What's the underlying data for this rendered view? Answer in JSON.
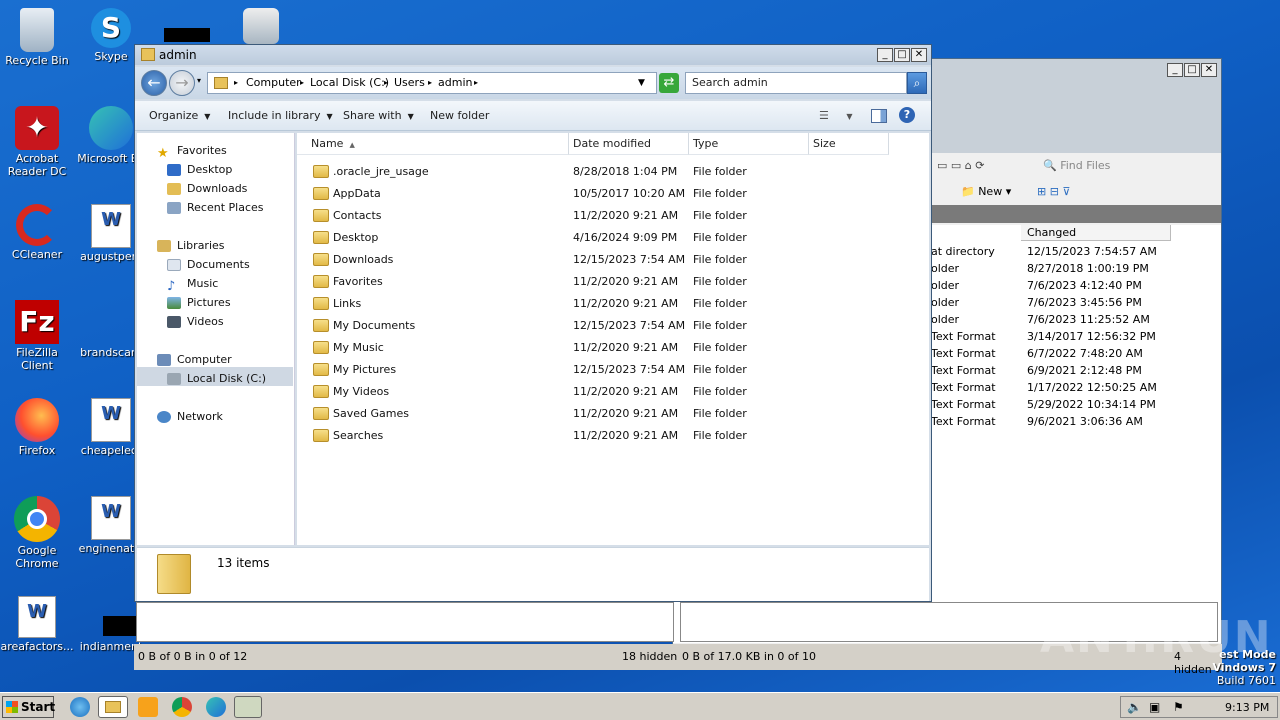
{
  "desktop": {
    "icons": [
      {
        "label": "Recycle Bin",
        "icon": "recycle-bin-icon"
      },
      {
        "label": "Skype",
        "icon": "skype-icon"
      },
      {
        "label": "Acrobat Reader DC",
        "icon": "acrobat-icon"
      },
      {
        "label": "Microsoft Ed",
        "icon": "edge-icon"
      },
      {
        "label": "CCleaner",
        "icon": "ccleaner-icon"
      },
      {
        "label": "augustpers",
        "icon": "word-doc-icon"
      },
      {
        "label": "FileZilla Client",
        "icon": "filezilla-icon"
      },
      {
        "label": "brandscare",
        "icon": "blank-doc-icon"
      },
      {
        "label": "Firefox",
        "icon": "firefox-icon"
      },
      {
        "label": "cheapelect",
        "icon": "word-doc-icon"
      },
      {
        "label": "Google Chrome",
        "icon": "chrome-icon"
      },
      {
        "label": "enginenatic",
        "icon": "word-doc-icon"
      },
      {
        "label": "areafactors...",
        "icon": "word-doc-icon"
      },
      {
        "label": "indianment",
        "icon": "blank-doc-icon"
      }
    ]
  },
  "explorer": {
    "title": "admin",
    "breadcrumb": [
      "Computer",
      "Local Disk (C:)",
      "Users",
      "admin"
    ],
    "search_placeholder": "Search admin",
    "toolbar": {
      "organize": "Organize",
      "include_in_library": "Include in library",
      "share_with": "Share with",
      "new_folder": "New folder"
    },
    "nav": {
      "favorites": "Favorites",
      "desktop": "Desktop",
      "downloads": "Downloads",
      "recent_places": "Recent Places",
      "libraries": "Libraries",
      "documents": "Documents",
      "music": "Music",
      "pictures": "Pictures",
      "videos": "Videos",
      "computer": "Computer",
      "local_disk": "Local Disk (C:)",
      "network": "Network"
    },
    "columns": {
      "name": "Name",
      "date": "Date modified",
      "type": "Type",
      "size": "Size"
    },
    "files": [
      {
        "name": ".oracle_jre_usage",
        "date": "8/28/2018 1:04 PM",
        "type": "File folder"
      },
      {
        "name": "AppData",
        "date": "10/5/2017 10:20 AM",
        "type": "File folder"
      },
      {
        "name": "Contacts",
        "date": "11/2/2020 9:21 AM",
        "type": "File folder"
      },
      {
        "name": "Desktop",
        "date": "4/16/2024 9:09 PM",
        "type": "File folder"
      },
      {
        "name": "Downloads",
        "date": "12/15/2023 7:54 AM",
        "type": "File folder"
      },
      {
        "name": "Favorites",
        "date": "11/2/2020 9:21 AM",
        "type": "File folder"
      },
      {
        "name": "Links",
        "date": "11/2/2020 9:21 AM",
        "type": "File folder"
      },
      {
        "name": "My Documents",
        "date": "12/15/2023 7:54 AM",
        "type": "File folder"
      },
      {
        "name": "My Music",
        "date": "11/2/2020 9:21 AM",
        "type": "File folder"
      },
      {
        "name": "My Pictures",
        "date": "12/15/2023 7:54 AM",
        "type": "File folder"
      },
      {
        "name": "My Videos",
        "date": "11/2/2020 9:21 AM",
        "type": "File folder"
      },
      {
        "name": "Saved Games",
        "date": "11/2/2020 9:21 AM",
        "type": "File folder"
      },
      {
        "name": "Searches",
        "date": "11/2/2020 9:21 AM",
        "type": "File folder"
      }
    ],
    "item_count": "13 items"
  },
  "back_window": {
    "find_files": "Find Files",
    "new": "New",
    "col_changed": "Changed",
    "rows": [
      {
        "type": "at directory",
        "changed": "12/15/2023 7:54:57 AM"
      },
      {
        "type": "older",
        "changed": "8/27/2018 1:00:19 PM"
      },
      {
        "type": "older",
        "changed": "7/6/2023 4:12:40 PM"
      },
      {
        "type": "older",
        "changed": "7/6/2023 3:45:56 PM"
      },
      {
        "type": "older",
        "changed": "7/6/2023 11:25:52 AM"
      },
      {
        "type": "Text Format",
        "changed": "3/14/2017 12:56:32 PM"
      },
      {
        "type": "Text Format",
        "changed": "6/7/2022 7:48:20 AM"
      },
      {
        "type": "Text Format",
        "changed": "6/9/2021 2:12:48 PM"
      },
      {
        "type": "Text Format",
        "changed": "1/17/2022 12:50:25 AM"
      },
      {
        "type": "Text Format",
        "changed": "5/29/2022 10:34:14 PM"
      },
      {
        "type": "Text Format",
        "changed": "9/6/2021 3:06:36 AM"
      }
    ],
    "status_left": "0 B of 0 B in 0 of 12",
    "hidden_left": "18 hidden",
    "status_right": "0 B of 17.0 KB in 0 of 10",
    "hidden_right": "4 hidden"
  },
  "watermark": {
    "line1": "est Mode",
    "line2": "Vindows 7",
    "line3": "Build 7601",
    "brand": "ANY.RUN"
  },
  "taskbar": {
    "start": "Start",
    "clock": "9:13 PM"
  }
}
